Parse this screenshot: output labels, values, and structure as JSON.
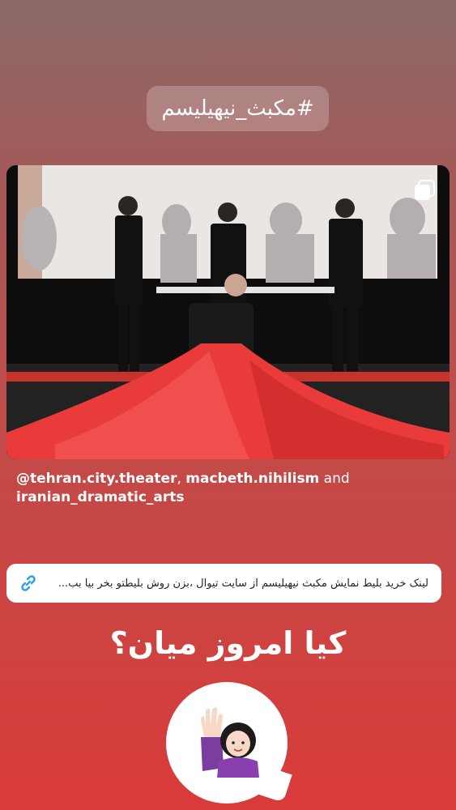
{
  "hashtag": "#مکبث_نیهیلیسم",
  "post": {
    "mention_user": "@tehran.city.theater",
    "mention_sep": ", ",
    "mention_user2": "macbeth.nihilism",
    "mention_and": " and",
    "mention_user3": "iranian_dramatic_arts"
  },
  "link_sticker": {
    "text": "لینک خرید بلیط نمایش مکبث نیهیلیسم از سایت تیوال ،بزن روش بلیطتو بخر بیا بب..."
  },
  "question": {
    "title": "کیا امروز میان؟"
  },
  "icons": {
    "multi": "multiple-posts-icon",
    "link": "link-icon",
    "emoji": "raising-hand-woman-emoji"
  },
  "colors": {
    "accent_red": "#e8403a",
    "link_blue": "#2f9ee8"
  }
}
